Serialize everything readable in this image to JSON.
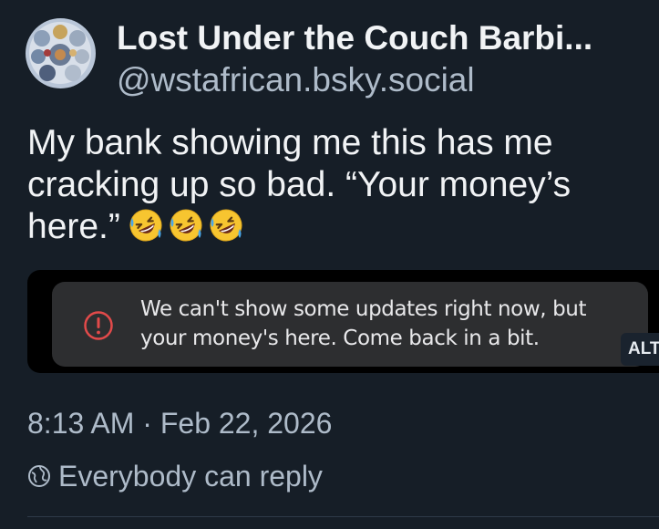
{
  "author": {
    "display_name": "Lost Under the Couch Barbi...",
    "handle": "@wstafrican.bsky.social",
    "avatar_icon": "avatar-image"
  },
  "post": {
    "text_lines": [
      "My bank showing me this has me",
      "cracking up so bad. “Your money’s",
      "here.”"
    ],
    "emoji_icon": "rolling-on-floor-laughing-emoji",
    "emoji_count": 3
  },
  "embed": {
    "notice_lines": [
      "We can't show some updates right now, but",
      "your money's here. Come back in a bit."
    ],
    "notice_icon": "alert-circle-icon",
    "alt_label": "ALT"
  },
  "meta": {
    "timestamp": "8:13 AM · Feb 22, 2026",
    "reply_setting": "Everybody can reply",
    "reply_icon": "globe-icon"
  },
  "colors": {
    "background": "#161e27",
    "text_primary": "#f1f3f5",
    "text_secondary": "#aebbc9",
    "alert_red": "#e24a4a",
    "card_bg": "#2d2e30"
  }
}
